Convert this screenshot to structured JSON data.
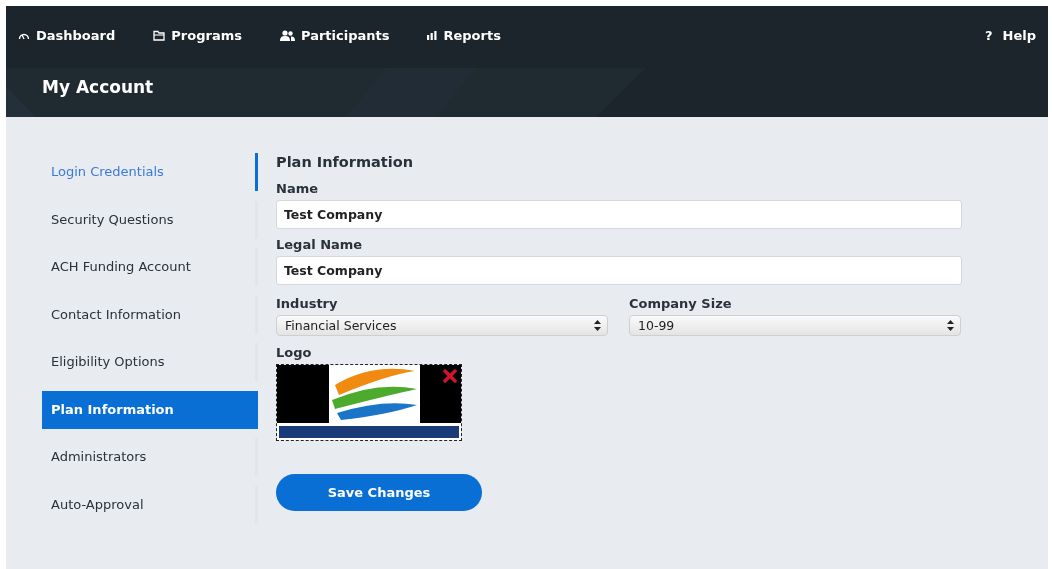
{
  "nav": {
    "items": [
      {
        "kind": "gauge",
        "label": "Dashboard"
      },
      {
        "kind": "folder",
        "label": "Programs"
      },
      {
        "kind": "people",
        "label": "Participants"
      },
      {
        "kind": "chart",
        "label": "Reports"
      }
    ],
    "help": {
      "icon": "?",
      "label": "Help"
    }
  },
  "page_title": "My Account",
  "sidebar": {
    "items": [
      {
        "label": "Login Credentials",
        "selected": false,
        "hovered": true
      },
      {
        "label": "Security Questions",
        "selected": false,
        "hovered": false
      },
      {
        "label": "ACH Funding Account",
        "selected": false,
        "hovered": false
      },
      {
        "label": "Contact Information",
        "selected": false,
        "hovered": false
      },
      {
        "label": "Eligibility Options",
        "selected": false,
        "hovered": false
      },
      {
        "label": "Plan Information",
        "selected": true,
        "hovered": false
      },
      {
        "label": "Administrators",
        "selected": false,
        "hovered": false
      },
      {
        "label": "Auto-Approval",
        "selected": false,
        "hovered": false
      }
    ]
  },
  "form": {
    "title": "Plan Information",
    "fields": [
      {
        "kind": "text",
        "label": "Name",
        "value": "Test Company"
      },
      {
        "kind": "text",
        "label": "Legal Name",
        "value": "Test Company"
      }
    ],
    "selects": [
      {
        "label": "Industry",
        "value": "Financial Services"
      },
      {
        "label": "Company Size",
        "value": "10-99"
      }
    ],
    "logo": {
      "label": "Logo",
      "kind": "picture"
    },
    "save_button": "Save Changes"
  }
}
